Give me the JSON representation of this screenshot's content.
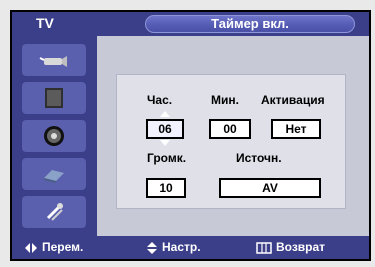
{
  "header": {
    "tv_label": "TV",
    "title": "Таймер вкл."
  },
  "sidebar": {
    "items": [
      {
        "icon": "antenna-icon"
      },
      {
        "icon": "monitor-icon"
      },
      {
        "icon": "speaker-icon"
      },
      {
        "icon": "pip-icon"
      },
      {
        "icon": "settings-icon"
      }
    ]
  },
  "form": {
    "hour_label": "Час.",
    "minute_label": "Мин.",
    "activation_label": "Активация",
    "volume_label": "Громк.",
    "source_label": "Источн.",
    "hour_value": "06",
    "minute_value": "00",
    "activation_value": "Нет",
    "volume_value": "10",
    "source_value": "AV"
  },
  "footer": {
    "move_label": "Перем.",
    "adjust_label": "Настр.",
    "return_label": "Возврат"
  },
  "colors": {
    "bar": "#3b3f8a",
    "panel": "#dfe0e8",
    "screen_bg": "#cfd1db"
  }
}
